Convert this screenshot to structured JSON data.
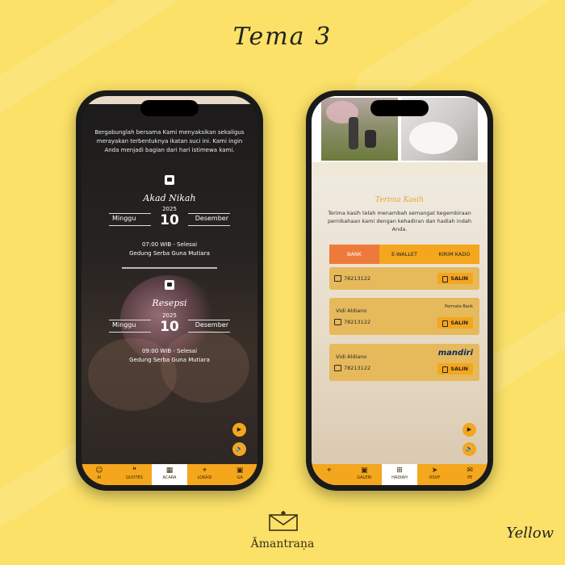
{
  "header": {
    "title": "Tema 3"
  },
  "brand": {
    "name": "Āmantraṇa"
  },
  "theme_label": "Yellow",
  "left_phone": {
    "intro": "Bergabunglah bersama Kami menyaksikan sekaligus merayakan terbentuknya ikatan suci ini. Kami ingin Anda menjadi bagian dari hari istimewa kami.",
    "akad": {
      "title": "Akad Nikah",
      "weekday": "Minggu",
      "year": "2025",
      "day": "10",
      "month": "Desember",
      "time": "07:00 WIB - Selesai",
      "venue": "Gedung Serba Guna Mutiara"
    },
    "resepsi": {
      "title": "Resepsi",
      "weekday": "Minggu",
      "year": "2025",
      "day": "10",
      "month": "Desember",
      "time": "09:00 WIB - Selesai",
      "venue": "Gedung Serba Guna Mutiara"
    },
    "nav": [
      {
        "label": "AI",
        "icon": "person-icon"
      },
      {
        "label": "QUOTES",
        "icon": "quote-icon"
      },
      {
        "label": "ACARA",
        "icon": "calendar-icon",
        "active": true
      },
      {
        "label": "LOKASI",
        "icon": "location-icon"
      },
      {
        "label": "GA",
        "icon": "gallery-icon"
      }
    ]
  },
  "right_phone": {
    "thanks_title": "Terima Kasih",
    "thanks_text": "Terima kasih telah menambah semangat kegembiraan pernikahaan kami dengan kehadiran dan hadiah indah Anda.",
    "tabs": [
      "BANK",
      "E-WALLET",
      "KIRIM KADO"
    ],
    "cards": [
      {
        "owner": "",
        "account": "78213122",
        "bank": "",
        "copy": "SALIN"
      },
      {
        "owner": "Vidi Aldiano",
        "account": "78213122",
        "bank": "Permata Bank",
        "copy": "SALIN"
      },
      {
        "owner": "Vidi Aldiano",
        "account": "78213122",
        "bank": "mandiri",
        "copy": "SALIN"
      }
    ],
    "nav": [
      {
        "label": "",
        "icon": "location-icon"
      },
      {
        "label": "GALERI",
        "icon": "gallery-icon"
      },
      {
        "label": "HADIAH",
        "icon": "gift-icon",
        "active": true
      },
      {
        "label": "RSVP",
        "icon": "send-icon"
      },
      {
        "label": "PE",
        "icon": "chat-icon"
      }
    ]
  },
  "colors": {
    "background": "#fbe167",
    "accent": "#f4a61d",
    "tab_active": "#ee7a3a"
  }
}
